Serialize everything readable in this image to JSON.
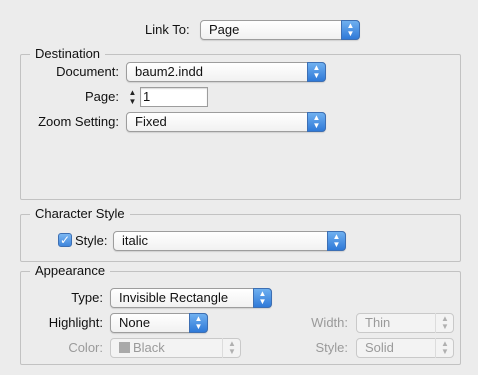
{
  "link_to": {
    "label": "Link To:",
    "value": "Page"
  },
  "destination": {
    "title": "Destination",
    "document_label": "Document:",
    "document_value": "baum2.indd",
    "page_label": "Page:",
    "page_value": "1",
    "zoom_label": "Zoom Setting:",
    "zoom_value": "Fixed"
  },
  "character_style": {
    "title": "Character Style",
    "style_label": "Style:",
    "style_checked": true,
    "style_value": "italic"
  },
  "appearance": {
    "title": "Appearance",
    "type_label": "Type:",
    "type_value": "Invisible Rectangle",
    "highlight_label": "Highlight:",
    "highlight_value": "None",
    "width_label": "Width:",
    "width_value": "Thin",
    "color_label": "Color:",
    "color_value": "Black",
    "style_label": "Style:",
    "style_value": "Solid"
  },
  "colors": {
    "popup_arrow_blue": "#2f79d8",
    "disabled_text": "#9a9a9a",
    "color_swatch": "#a9a9a9"
  }
}
